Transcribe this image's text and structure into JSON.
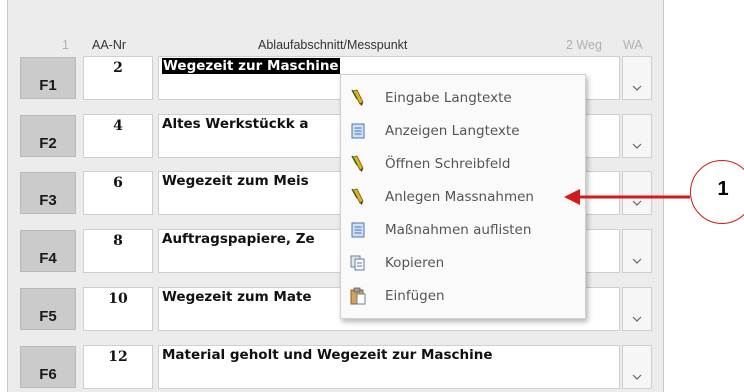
{
  "columns": {
    "index": "1",
    "aa_nr": "AA-Nr",
    "step": "Ablaufabschnitt/Messpunkt",
    "weg": "2 Weg",
    "wa": "WA"
  },
  "rows": [
    {
      "fkey": "F1",
      "nr": "2",
      "text": "Wegezeit zur Maschine",
      "selected": true
    },
    {
      "fkey": "F2",
      "nr": "4",
      "text": "Altes Werkstückk a"
    },
    {
      "fkey": "F3",
      "nr": "6",
      "text": "Wegezeit zum Meis"
    },
    {
      "fkey": "F4",
      "nr": "8",
      "text": "Auftragspapiere, Ze"
    },
    {
      "fkey": "F5",
      "nr": "10",
      "text": "Wegezeit zum Mate"
    },
    {
      "fkey": "F6",
      "nr": "12",
      "text": "Material geholt und Wegezeit zur Maschine"
    }
  ],
  "context_menu": [
    {
      "label": "Eingabe Langtexte",
      "icon": "pencil-icon"
    },
    {
      "label": "Anzeigen Langtexte",
      "icon": "document-icon"
    },
    {
      "label": "Öffnen Schreibfeld",
      "icon": "pencil-icon"
    },
    {
      "label": "Anlegen Massnahmen",
      "icon": "pencil-icon"
    },
    {
      "label": "Maßnahmen auflisten",
      "icon": "document-icon"
    },
    {
      "label": "Kopieren",
      "icon": "copy-icon"
    },
    {
      "label": "Einfügen",
      "icon": "paste-icon"
    }
  ],
  "callout": {
    "number": "1"
  },
  "colors": {
    "callout": "#d21a1a",
    "highlight_text_bg": "#000000",
    "fkey_bg": "#cbcbcb"
  }
}
